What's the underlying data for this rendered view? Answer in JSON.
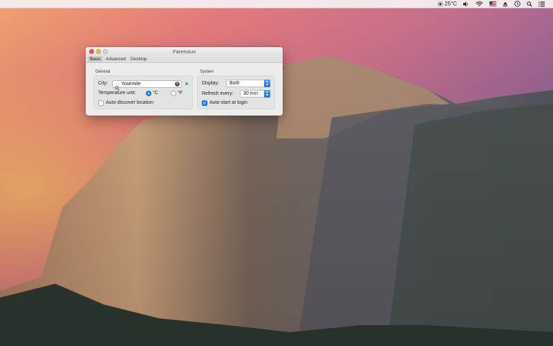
{
  "menubar": {
    "weather_text": "25°C",
    "icons": [
      "sun-icon",
      "volume-icon",
      "wifi-icon",
      "us-flag-icon",
      "eject-icon",
      "clock-icon",
      "search-icon",
      "list-icon"
    ]
  },
  "window": {
    "title": "Farensius",
    "tabs": [
      {
        "label": "Basic",
        "active": true
      },
      {
        "label": "Advanced",
        "active": false
      },
      {
        "label": "Desktop",
        "active": false
      }
    ]
  },
  "general": {
    "heading": "General",
    "city_label": "City:",
    "city_value": "Yosemite",
    "temp_unit_label": "Temperature unit:",
    "celsius_label": "°C",
    "celsius_selected": true,
    "fahrenheit_label": "°F",
    "fahrenheit_selected": false,
    "auto_discover_label": "Auto-discover location",
    "auto_discover_checked": false
  },
  "system": {
    "heading": "System",
    "display_label": "Display:",
    "display_value": "Both",
    "refresh_label": "Refresh every:",
    "refresh_value": "30 min",
    "autostart_label": "Auto-start at login",
    "autostart_checked": true
  },
  "colors": {
    "accent": "#2a84f5",
    "status_ok": "#33c84a",
    "close": "#fc5b57",
    "minimize": "#e5bf3c"
  }
}
